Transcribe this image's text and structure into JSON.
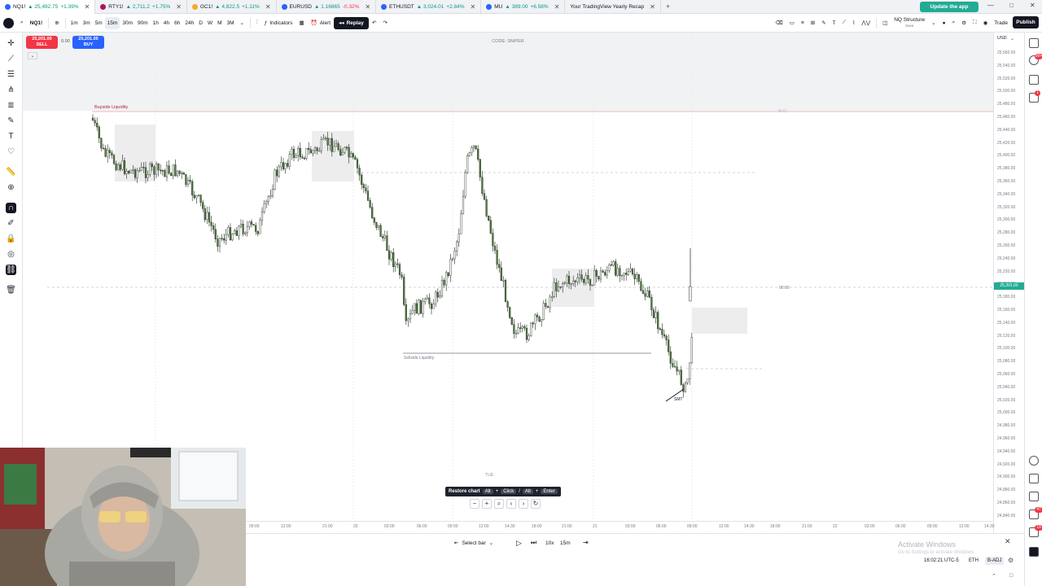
{
  "browser": {
    "tabs": [
      {
        "symbol": "NQ1!",
        "price": "▲ 25,492.75",
        "change": "+1.39%",
        "dir": "up"
      },
      {
        "symbol": "RTY1!",
        "price": "▲ 2,711.2",
        "change": "+1.75%",
        "dir": "up"
      },
      {
        "symbol": "GC1!",
        "price": "▲ 4,822.5",
        "change": "+1.11%",
        "dir": "up"
      },
      {
        "symbol": "EURUSD",
        "price": "▲ 1.16865",
        "change": "-0.32%",
        "dir": "down"
      },
      {
        "symbol": "ETHUSDT",
        "price": "▲ 3,024.01",
        "change": "+2.84%",
        "dir": "up"
      },
      {
        "symbol": "MU",
        "price": "▲ 389.00",
        "change": "+6.58%",
        "dir": "up"
      },
      {
        "symbol": "Your TradingView Yearly Recap",
        "price": "",
        "change": "",
        "dir": ""
      }
    ],
    "update_label": "Update the app"
  },
  "toolbar": {
    "symbol": "NQ1!",
    "intervals": [
      "1m",
      "3m",
      "5m",
      "15m",
      "30m",
      "90m",
      "1h",
      "4h",
      "6h",
      "24h",
      "D",
      "W",
      "M",
      "3M"
    ],
    "selected_interval": "15m",
    "indicators_label": "Indicators",
    "alert_label": "Alert",
    "replay_label": "Replay",
    "layout_name": "NQ Structure",
    "layout_sub": "Save",
    "trade_label": "Trade",
    "publish_label": "Publish"
  },
  "chart": {
    "sell_price": "25,201.00",
    "sell_label": "SELL",
    "spread": "0.00",
    "buy_price": "25,201.00",
    "buy_label": "BUY",
    "watermark": "CODE: SNIPER",
    "buyside_label": "Buyside Liquidity",
    "sellside_label": "Sellside Liquidity",
    "day_label": "TUE",
    "current_price": "25,201.00",
    "countdown": "00:00",
    "level_wo": "W.O",
    "smt_label": "SMT"
  },
  "price_axis": {
    "currency": "USD",
    "ticks": [
      "25,560.00",
      "25,540.00",
      "25,520.00",
      "25,500.00",
      "25,480.00",
      "25,460.00",
      "25,440.00",
      "25,420.00",
      "25,400.00",
      "25,380.00",
      "25,360.00",
      "25,340.00",
      "25,320.00",
      "25,300.00",
      "25,280.00",
      "25,260.00",
      "25,240.00",
      "25,220.00",
      "25,200.00",
      "25,180.00",
      "25,160.00",
      "25,140.00",
      "25,120.00",
      "25,100.00",
      "25,080.00",
      "25,060.00",
      "25,040.00",
      "25,020.00",
      "25,000.00",
      "24,980.00",
      "24,960.00",
      "24,940.00",
      "24,920.00",
      "24,900.00",
      "24,880.00",
      "24,860.00",
      "24,840.00"
    ]
  },
  "time_axis": {
    "ticks": [
      "09:00",
      "12:00",
      "21:00",
      "20",
      "03:00",
      "06:00",
      "09:00",
      "12:00",
      "14:30",
      "18:00",
      "21:00",
      "21",
      "03:00",
      "06:00",
      "09:00",
      "12:00",
      "14:30",
      "18:00",
      "21:00",
      "22",
      "03:00",
      "06:00",
      "09:00",
      "12:00",
      "14:30"
    ]
  },
  "replay_controls": {
    "restore_label": "Restore chart",
    "keys": [
      "Alt",
      "+",
      "Click",
      "/",
      "Alt",
      "+",
      "Enter"
    ],
    "select_bar_label": "Select bar",
    "speed": "10x",
    "interval": "15m"
  },
  "footer": {
    "activate_title": "Activate Windows",
    "activate_sub": "Go to Settings to activate Windows.",
    "clock": "16:02:21 UTC-5",
    "session": "ETH",
    "adj": "B-ADJ"
  },
  "colors": {
    "bull": "#ffffff",
    "bull_border": "#1e2a1e",
    "bear": "#4f7a3d",
    "accent": "#2962ff",
    "sell": "#f23645",
    "buy": "#2962ff",
    "price_tag": "#22ab94"
  }
}
